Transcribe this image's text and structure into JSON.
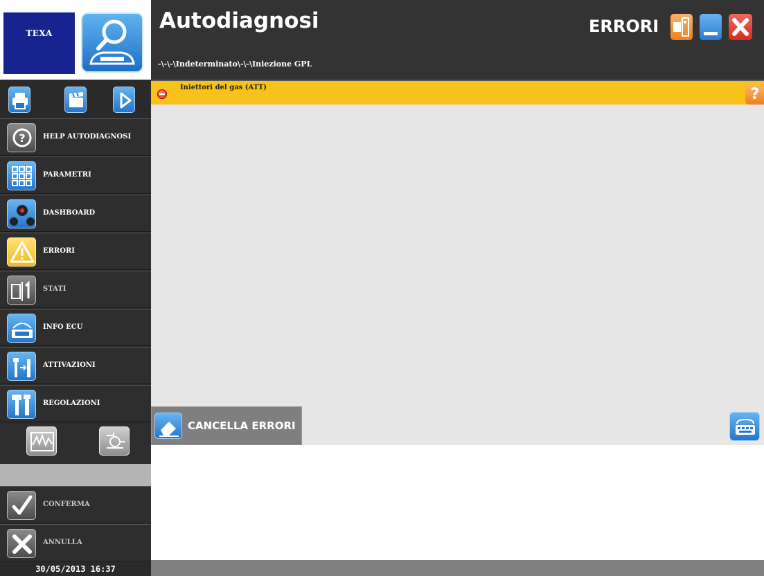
{
  "logo": {
    "brand": "TEXA"
  },
  "header": {
    "title": "Autodiagnosi",
    "path": "-\\-\\-\\Indeterminato\\-\\-\\Iniezione GPL",
    "section": "ERRORI"
  },
  "toolbar": {
    "icons": [
      "printer-icon",
      "clapperboard-icon",
      "play-icon"
    ]
  },
  "sidebar": {
    "items": [
      {
        "label": "HELP AUTODIAGNOSI",
        "icon": "help-icon"
      },
      {
        "label": "PARAMETRI",
        "icon": "grid-icon"
      },
      {
        "label": "DASHBOARD",
        "icon": "dashboard-icon"
      },
      {
        "label": "ERRORI",
        "icon": "warning-icon"
      },
      {
        "label": "STATI",
        "icon": "switch-icon"
      },
      {
        "label": "INFO ECU",
        "icon": "info-icon"
      },
      {
        "label": "ATTIVAZIONI",
        "icon": "activation-icon"
      },
      {
        "label": "REGOLAZIONI",
        "icon": "tools-icon"
      }
    ],
    "confirm": "CONFERMA",
    "cancel": "ANNULLA",
    "datetime": "30/05/2013 16:37"
  },
  "errors": [
    {
      "text": "Iniettori del gas (ATT)"
    }
  ],
  "main": {
    "clear_button": "CANCELLA ERRORI",
    "help_glyph": "?"
  },
  "colors": {
    "header_bg": "#333333",
    "error_row": "#f7c21b",
    "accent_blue": "#2675cc",
    "texa_blue": "#17248f"
  }
}
